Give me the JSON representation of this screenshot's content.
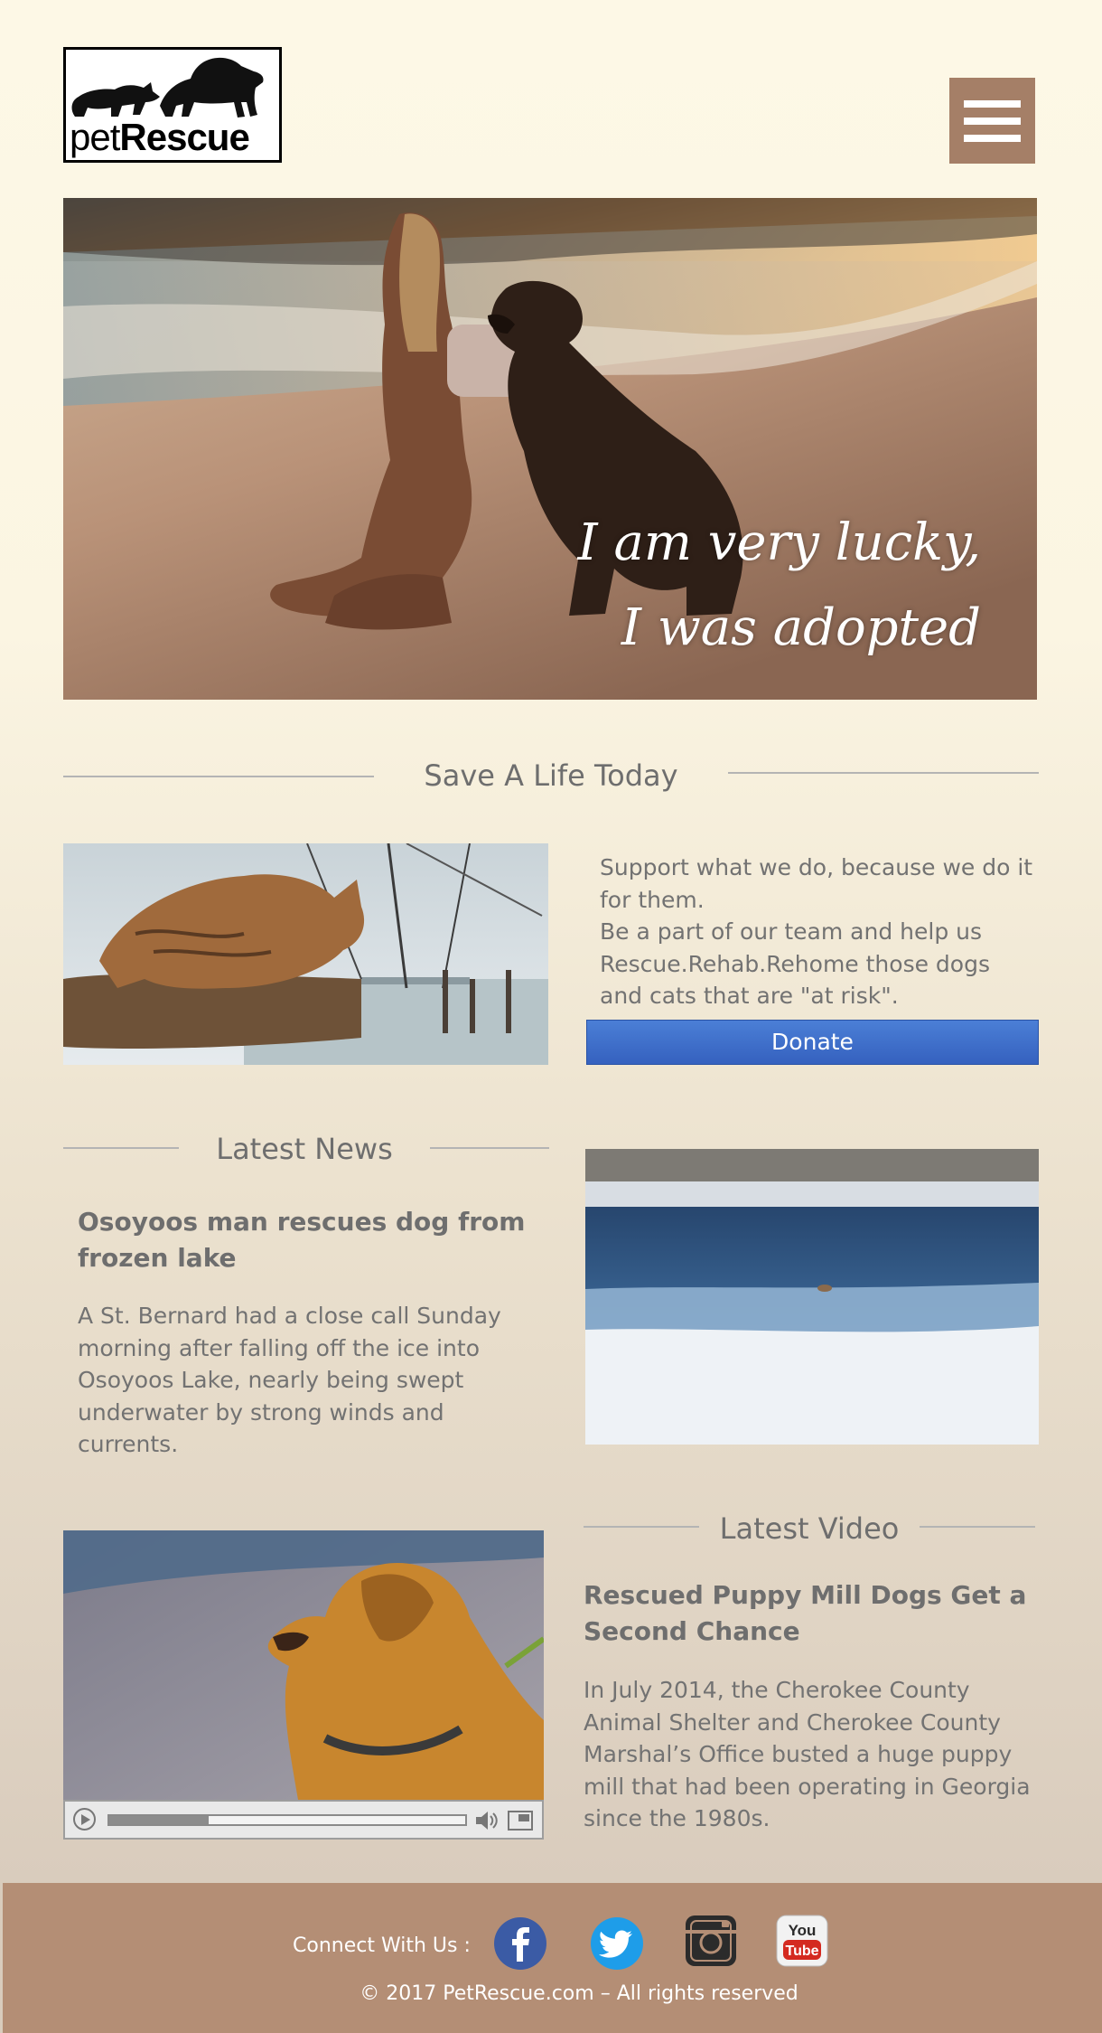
{
  "brand": {
    "logo_word_light": "pet",
    "logo_word_bold": "Rescue"
  },
  "hero": {
    "caption_line1": "I am very lucky,",
    "caption_line2": "I was adopted"
  },
  "save_section": {
    "heading": "Save A Life Today",
    "paragraph1": "Support what we do, because we do it for them.",
    "paragraph2": "Be a part of our team and help us Rescue.Rehab.Rehome those dogs and cats that are \"at risk\".",
    "donate_label": "Donate"
  },
  "news": {
    "heading": "Latest News",
    "title": "Osoyoos man rescues dog from frozen lake",
    "body": "A St. Bernard had a close call Sunday morning after falling off the ice into Osoyoos Lake, nearly being swept underwater by strong winds and currents."
  },
  "video": {
    "heading": "Latest Video",
    "title": "Rescued Puppy Mill Dogs Get a Second Chance",
    "body": "In July 2014, the Cherokee County Animal Shelter and Cherokee County Marshal’s Office busted a huge puppy mill that had been operating in Georgia since the 1980s.",
    "progress": 0.28
  },
  "footer": {
    "connect_label": "Connect With Us :",
    "social": [
      "facebook-icon",
      "twitter-icon",
      "instagram-icon",
      "youtube-icon"
    ],
    "copyright": "© 2017 PetRescue.com – All rights reserved"
  },
  "colors": {
    "accent_brown": "#b48e75",
    "menu_brown": "#a57f67",
    "donate_blue": "#3a6bcc",
    "heading_gray": "#6e6e6e"
  }
}
